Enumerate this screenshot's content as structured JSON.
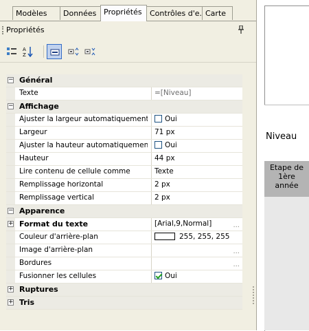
{
  "tabs": [
    "Modèles",
    "Données",
    "Propriétés",
    "Contrôles d'e..",
    "Carte"
  ],
  "panel": {
    "title": "Propriétés",
    "pin_glyph": "ᵖ"
  },
  "rows": [
    {
      "type": "cat",
      "label": "Général",
      "sign": "−"
    },
    {
      "type": "prop",
      "label": "Texte",
      "value": "=[Niveau]",
      "muted": true
    },
    {
      "type": "cat",
      "label": "Affichage",
      "sign": "−"
    },
    {
      "type": "prop",
      "label": "Ajuster la largeur automatiquement",
      "value": "Oui",
      "checkbox": false
    },
    {
      "type": "prop",
      "label": "Largeur",
      "value": "71 px"
    },
    {
      "type": "prop",
      "label": "Ajuster la hauteur automatiquement",
      "value": "Oui",
      "checkbox": false
    },
    {
      "type": "prop",
      "label": "Hauteur",
      "value": "44 px"
    },
    {
      "type": "prop",
      "label": "Lire contenu de cellule comme",
      "value": "Texte"
    },
    {
      "type": "prop",
      "label": "Remplissage horizontal",
      "value": "2 px"
    },
    {
      "type": "prop",
      "label": "Remplissage vertical",
      "value": "2 px"
    },
    {
      "type": "cat",
      "label": "Apparence",
      "sign": "−"
    },
    {
      "type": "cat",
      "label": "Format du texte",
      "sign": "+",
      "value": "[Arial,9,Normal]",
      "ellipsis": true,
      "white": true
    },
    {
      "type": "prop",
      "label": "Couleur d'arrière-plan",
      "value": "255, 255, 255",
      "swatch": "#ffffff"
    },
    {
      "type": "prop",
      "label": "Image d'arrière-plan",
      "value": "",
      "ellipsis": true
    },
    {
      "type": "prop",
      "label": "Bordures",
      "value": "",
      "ellipsis": true
    },
    {
      "type": "prop",
      "label": "Fusionner les cellules",
      "value": "Oui",
      "checkbox": true
    },
    {
      "type": "cat",
      "label": "Ruptures",
      "sign": "+"
    },
    {
      "type": "cat",
      "label": "Tris",
      "sign": "+"
    }
  ],
  "preview": {
    "header_text": "Niveau",
    "cell_text_lines": [
      "Etape de",
      "1ère",
      "année"
    ]
  },
  "colors": {
    "panel_bg": "#f1efe2",
    "selected_btn": "#c1d2ee",
    "cell_gray": "#b4b4b4"
  }
}
